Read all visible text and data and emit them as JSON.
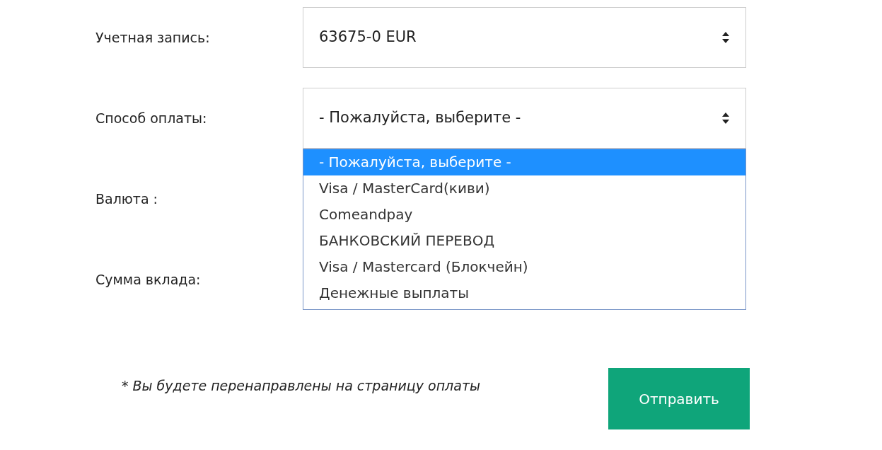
{
  "fields": [
    {
      "label": "Учетная запись:",
      "value": "63675-0 EUR"
    },
    {
      "label": "Способ оплаты:",
      "value": "- Пожалуйста, выберите -",
      "expanded": true,
      "options": [
        {
          "label": "- Пожалуйста, выберите -",
          "selected": true
        },
        {
          "label": "Visa / MasterCard(киви)",
          "selected": false
        },
        {
          "label": "Comeandpay",
          "selected": false
        },
        {
          "label": "БАНКОВСКИЙ ПЕРЕВОД",
          "selected": false
        },
        {
          "label": "Visa / Mastercard (Блокчейн)",
          "selected": false
        },
        {
          "label": "Денежные выплаты",
          "selected": false
        }
      ]
    },
    {
      "label": "Валюта :"
    },
    {
      "label": "Сумма вклада:"
    }
  ],
  "note": "* Вы будете перенаправлены на страницу оплаты",
  "submit_button": "Отправить"
}
